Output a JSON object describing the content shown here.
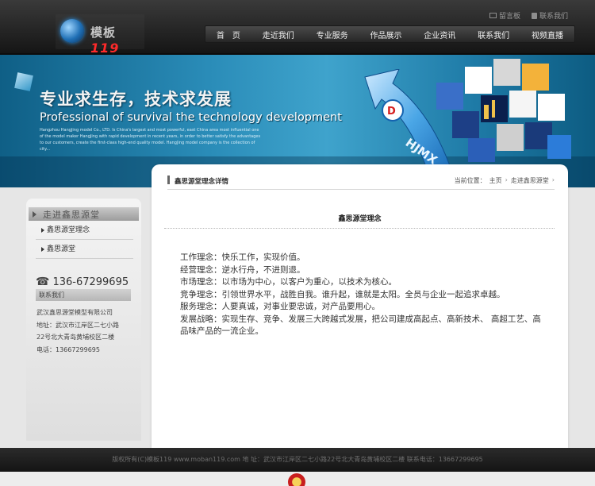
{
  "header": {
    "logo_text": "模板",
    "logo_num": "119",
    "toplinks": [
      "留言板",
      "联系我们"
    ],
    "nav": [
      "首　页",
      "走近我们",
      "专业服务",
      "作品展示",
      "企业资讯",
      "联系我们",
      "视频直播"
    ]
  },
  "banner": {
    "slogan_cn": "专业求生存，技术求发展",
    "slogan_en": "Professional of survival the technology development",
    "intro": "Hangzhou HangJing model Co., LTD. Is China's largest and most powerful, east China area most influential one of the model maker HangJing with rapid development in recent years, in order to better satisfy the advantages to our customers, create the first-class high-end quality model. HangJing model company is the collection of city..."
  },
  "sidebar": {
    "title": "走进鑫思源堂",
    "items": [
      "鑫思源堂理念",
      "鑫思源堂"
    ],
    "phone": "136-67299695",
    "contact_label": "联系我们",
    "contact_lines": [
      "武汉鑫思源堂模型有限公司",
      "地址：武汉市江岸区二七小路",
      "22号北大青岛黄埔校区二楼",
      "电话：13667299695"
    ]
  },
  "main": {
    "heading": "鑫思源堂理念详情",
    "breadcrumb_label": "当前位置：",
    "breadcrumb": [
      "主页",
      "走进鑫思源堂"
    ],
    "article_title": "鑫思源堂理念",
    "body": [
      "工作理念：快乐工作，实现价值。",
      "经营理念：逆水行舟，不进则退。",
      "市场理念：以市场为中心，以客户为重心，以技术为核心。",
      "竞争理念：引领世界水平，战胜自我。谁升起，谁就是太阳。全员与企业一起追求卓越。",
      "服务理念：人要真诚，对事业要忠诚，对产品要用心。",
      "发展战略：实现生存、竞争、发展三大跨越式发展，把公司建成高起点、高新技术、 高超工艺、高品味产品的一流企业。"
    ]
  },
  "footer": {
    "text": "版权所有(C)模板119 www.moban119.com 地 址：武汉市江岸区二七小路22号北大青岛黄埔校区二楼 联系电话：13667299695"
  },
  "colors": {
    "banner": "#2a8cb8",
    "header": "#1a1a1a",
    "footer": "#1e1e1e"
  }
}
